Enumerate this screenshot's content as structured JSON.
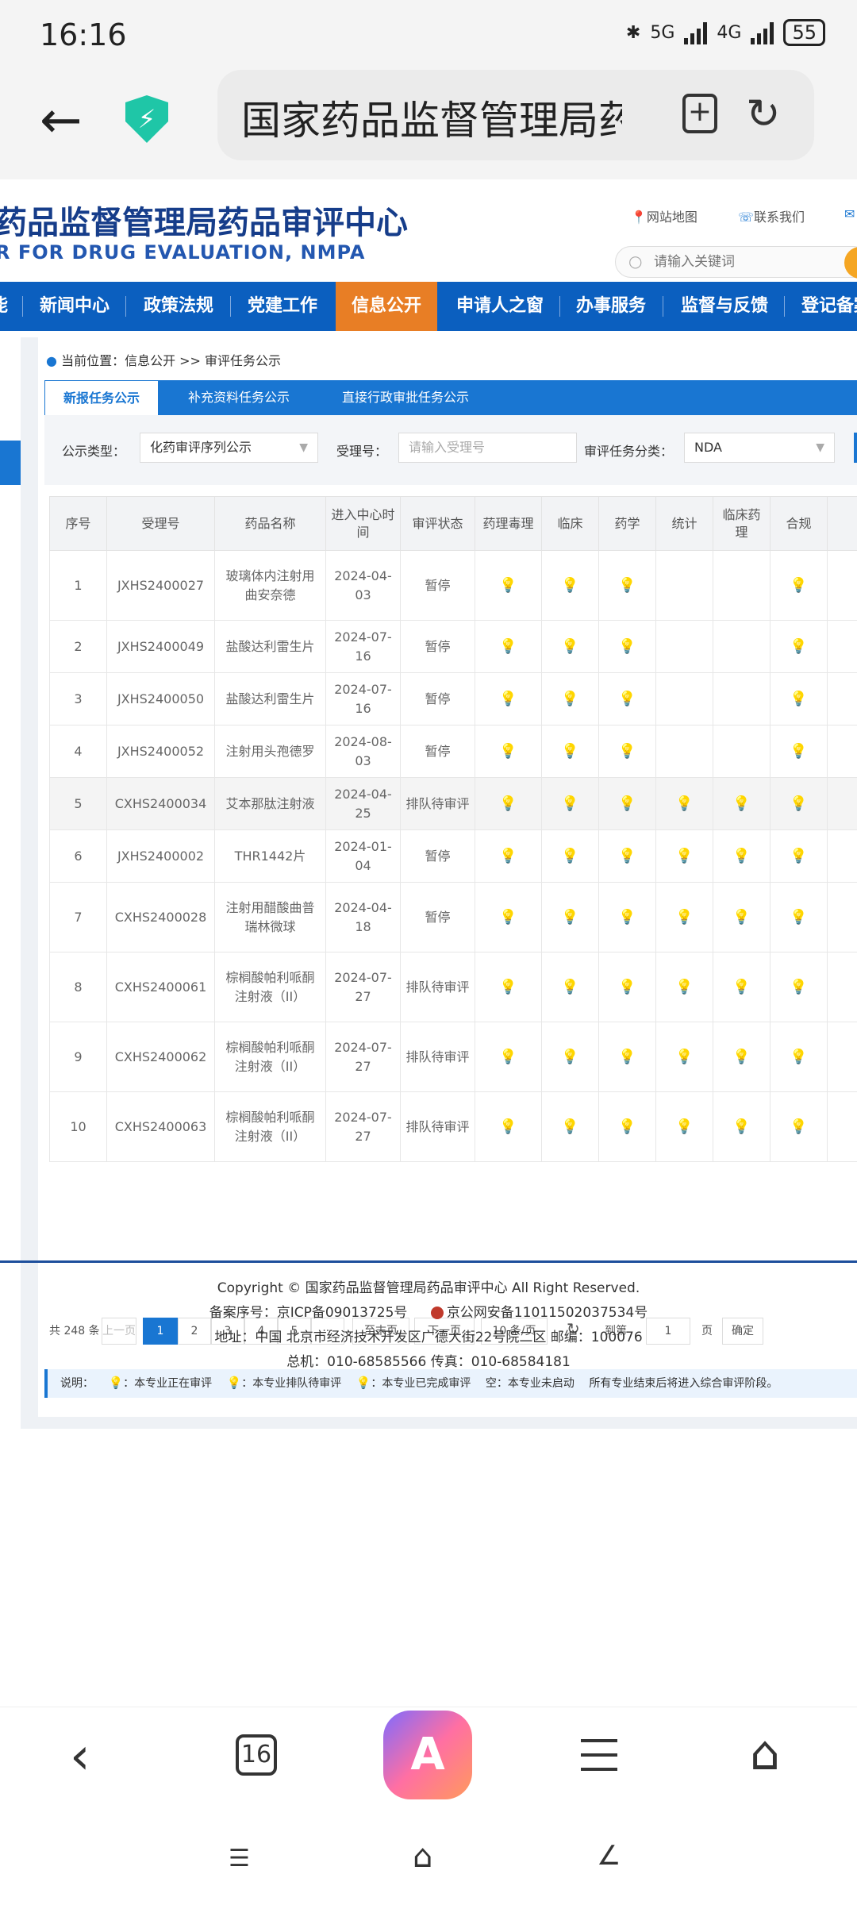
{
  "status_bar": {
    "time": "16:16",
    "net1": "5G",
    "net2": "4G",
    "battery": "55"
  },
  "browser": {
    "url_text": "国家药品监督管理局药",
    "tab_count": "16",
    "ai_label": "A"
  },
  "site": {
    "title": "药品监督管理局药品审评中心",
    "subtitle": "R FOR DRUG EVALUATION, NMPA",
    "link_sitemap": "网站地图",
    "link_contact": "联系我们",
    "search_placeholder": "请输入关键词"
  },
  "nav": [
    "能",
    "新闻中心",
    "政策法规",
    "党建工作",
    "信息公开",
    "申请人之窗",
    "办事服务",
    "监督与反馈",
    "登记备案"
  ],
  "breadcrumb": "当前位置：信息公开 >> 审评任务公示",
  "tabs": [
    "新报任务公示",
    "补充资料任务公示",
    "直接行政审批任务公示"
  ],
  "filters": {
    "type_label": "公示类型：",
    "type_value": "化药审评序列公示",
    "accept_label": "受理号：",
    "accept_placeholder": "请输入受理号",
    "category_label": "审评任务分类：",
    "category_value": "NDA"
  },
  "table": {
    "headers": [
      "序号",
      "受理号",
      "药品名称",
      "进入中心时间",
      "审评状态",
      "药理毒理",
      "临床",
      "药学",
      "统计",
      "临床药理",
      "合规"
    ],
    "rows": [
      {
        "no": "1",
        "acc": "JXHS2400027",
        "name": "玻璃体内注射用曲安奈德",
        "date": "2024-04-03",
        "status": "暂停",
        "lights": [
          "off",
          "off",
          "off",
          "",
          "",
          "off"
        ]
      },
      {
        "no": "2",
        "acc": "JXHS2400049",
        "name": "盐酸达利雷生片",
        "date": "2024-07-16",
        "status": "暂停",
        "lights": [
          "off",
          "off",
          "on",
          "",
          "",
          "off"
        ]
      },
      {
        "no": "3",
        "acc": "JXHS2400050",
        "name": "盐酸达利雷生片",
        "date": "2024-07-16",
        "status": "暂停",
        "lights": [
          "off",
          "off",
          "on",
          "",
          "",
          "off"
        ]
      },
      {
        "no": "4",
        "acc": "JXHS2400052",
        "name": "注射用头孢德罗",
        "date": "2024-08-03",
        "status": "暂停",
        "lights": [
          "off",
          "off",
          "on",
          "",
          "",
          "off"
        ]
      },
      {
        "no": "5",
        "acc": "CXHS2400034",
        "name": "艾本那肽注射液",
        "date": "2024-04-25",
        "status": "排队待审评",
        "lights": [
          "off",
          "on",
          "on",
          "off",
          "off",
          "off"
        ]
      },
      {
        "no": "6",
        "acc": "JXHS2400002",
        "name": "THR1442片",
        "date": "2024-01-04",
        "status": "暂停",
        "lights": [
          "off",
          "off",
          "on",
          "off",
          "off",
          "off"
        ]
      },
      {
        "no": "7",
        "acc": "CXHS2400028",
        "name": "注射用醋酸曲普瑞林微球",
        "date": "2024-04-18",
        "status": "暂停",
        "lights": [
          "off",
          "off",
          "on",
          "off",
          "off",
          "off"
        ]
      },
      {
        "no": "8",
        "acc": "CXHS2400061",
        "name": "棕榈酸帕利哌酮注射液（II）",
        "date": "2024-07-27",
        "status": "排队待审评",
        "lights": [
          "off",
          "off",
          "on",
          "off",
          "off",
          "off"
        ]
      },
      {
        "no": "9",
        "acc": "CXHS2400062",
        "name": "棕榈酸帕利哌酮注射液（II）",
        "date": "2024-07-27",
        "status": "排队待审评",
        "lights": [
          "off",
          "off",
          "on",
          "off",
          "off",
          "off"
        ]
      },
      {
        "no": "10",
        "acc": "CXHS2400063",
        "name": "棕榈酸帕利哌酮注射液（II）",
        "date": "2024-07-27",
        "status": "排队待审评",
        "lights": [
          "off",
          "off",
          "on",
          "off",
          "off",
          "off"
        ]
      }
    ]
  },
  "pagination": {
    "total": "共 248 条",
    "prev": "上一页",
    "pages": [
      "1",
      "2",
      "3",
      "4",
      "5",
      "···"
    ],
    "last": "至末页",
    "next": "下一页",
    "per_page": "10 条/页",
    "goto_label": "到第",
    "goto_value": "1",
    "page_unit": "页",
    "confirm": "确定"
  },
  "legend": {
    "title": "说明：",
    "a": "：本专业正在审评",
    "b": "：本专业排队待审评",
    "c": "：本专业已完成审评",
    "d": "空：本专业未启动",
    "e": "所有专业结束后将进入综合审评阶段。"
  },
  "footer": {
    "copyright": "Copyright © 国家药品监督管理局药品审评中心  All Right Reserved.",
    "icp": "备案序号：京ICP备09013725号",
    "police": "京公网安备11011502037534号",
    "address": "地址：中国 北京市经济技术开发区广德大街22号院二区    邮编：100076",
    "phone": "总机：010-68585566    传真：010-68584181"
  },
  "colors": {
    "nav_blue": "#0b5fbf",
    "nav_active": "#e87e25",
    "tab_blue": "#1976d2",
    "bulb_on": "#e8c53a",
    "bulb_off": "#c8c8c8"
  }
}
